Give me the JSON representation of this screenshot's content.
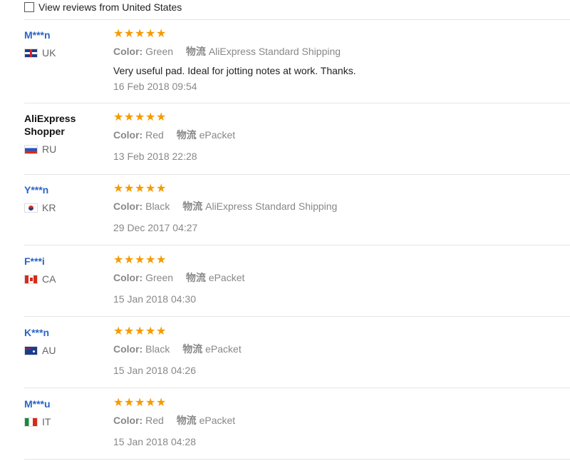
{
  "filter": {
    "label": "View reviews from United States",
    "checked": false
  },
  "reviews": [
    {
      "name": "M***n",
      "name_color": "#2a63c6",
      "flag": "uk-flag-icon",
      "country": "UK",
      "stars": 5,
      "color_key": "Color:",
      "color_value": "Green",
      "ship_key": "物流",
      "ship_value": "AliExpress Standard Shipping",
      "comment": "Very useful pad. Ideal for jotting notes at work. Thanks.",
      "date": "16 Feb 2018 09:54"
    },
    {
      "name": "AliExpress Shopper",
      "name_color": "#111111",
      "flag": "ru-flag-icon",
      "country": "RU",
      "stars": 5,
      "color_key": "Color:",
      "color_value": "Red",
      "ship_key": "物流",
      "ship_value": "ePacket",
      "comment": "",
      "date": "13 Feb 2018 22:28"
    },
    {
      "name": "Y***n",
      "name_color": "#2a63c6",
      "flag": "kr-flag-icon",
      "country": "KR",
      "stars": 5,
      "color_key": "Color:",
      "color_value": "Black",
      "ship_key": "物流",
      "ship_value": "AliExpress Standard Shipping",
      "comment": "",
      "date": "29 Dec 2017 04:27"
    },
    {
      "name": "F***i",
      "name_color": "#2a63c6",
      "flag": "ca-flag-icon",
      "country": "CA",
      "stars": 5,
      "color_key": "Color:",
      "color_value": "Green",
      "ship_key": "物流",
      "ship_value": "ePacket",
      "comment": "",
      "date": "15 Jan 2018 04:30"
    },
    {
      "name": "K***n",
      "name_color": "#2a63c6",
      "flag": "au-flag-icon",
      "country": "AU",
      "stars": 5,
      "color_key": "Color:",
      "color_value": "Black",
      "ship_key": "物流",
      "ship_value": "ePacket",
      "comment": "",
      "date": "15 Jan 2018 04:26"
    },
    {
      "name": "M***u",
      "name_color": "#2a63c6",
      "flag": "it-flag-icon",
      "country": "IT",
      "stars": 5,
      "color_key": "Color:",
      "color_value": "Red",
      "ship_key": "物流",
      "ship_value": "ePacket",
      "comment": "",
      "date": "15 Jan 2018 04:28"
    }
  ]
}
